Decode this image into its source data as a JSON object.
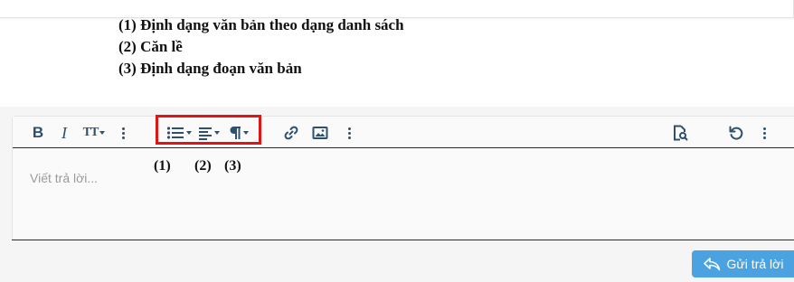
{
  "legend": {
    "item1": "(1) Định dạng văn bản theo dạng danh sách",
    "item2": "(2) Căn lề",
    "item3": "(3) Định dạng đoạn văn bản"
  },
  "toolbar": {
    "bold_label": "B",
    "italic_label": "I",
    "text_size_label": "TT",
    "icons": [
      "bold-icon",
      "italic-icon",
      "text-size-icon",
      "more-icon",
      "list-icon",
      "align-icon",
      "paragraph-icon",
      "link-icon",
      "image-icon",
      "more-icon",
      "preview-icon",
      "undo-icon",
      "more-icon"
    ]
  },
  "annotations": {
    "n1": "(1)",
    "n2": "(2)",
    "n3": "(3)"
  },
  "editor": {
    "placeholder": "Viết trả lời..."
  },
  "submit": {
    "label": "Gửi trả lời"
  },
  "colors": {
    "toolbar_icon": "#2f4f6f",
    "highlight": "#e01515",
    "submit_bg": "#4aa3e0"
  }
}
